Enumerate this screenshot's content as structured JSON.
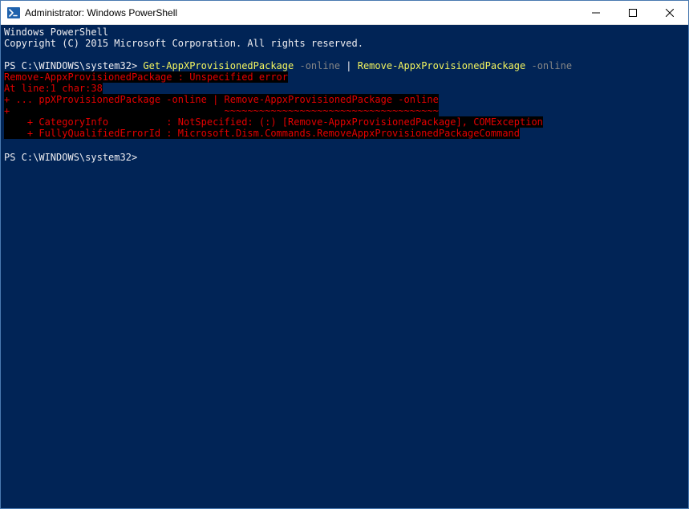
{
  "window": {
    "title": "Administrator: Windows PowerShell"
  },
  "terminal": {
    "banner1": "Windows PowerShell",
    "banner2": "Copyright (C) 2015 Microsoft Corporation. All rights reserved.",
    "prompt1": "PS C:\\WINDOWS\\system32> ",
    "cmd1_a": "Get-AppXProvisionedPackage ",
    "cmd1_b": "-online ",
    "cmd1_c": "| ",
    "cmd1_d": "Remove-AppxProvisionedPackage ",
    "cmd1_e": "-online",
    "err1": "Remove-AppxProvisionedPackage : Unspecified error",
    "err2": "At line:1 char:38",
    "err3_a": "+ ... ppXProvisionedPackage -online | ",
    "err3_b": "Remove-AppxProvisionedPackage -online",
    "err4_a": "+                                     ",
    "err4_b": "~~~~~~~~~~~~~~~~~~~~~~~~~~~~~~~~~~~~~",
    "err5": "    + CategoryInfo          : NotSpecified: (:) [Remove-AppxProvisionedPackage], COMException",
    "err6": "    + FullyQualifiedErrorId : Microsoft.Dism.Commands.RemoveAppxProvisionedPackageCommand",
    "prompt2": "PS C:\\WINDOWS\\system32> "
  }
}
